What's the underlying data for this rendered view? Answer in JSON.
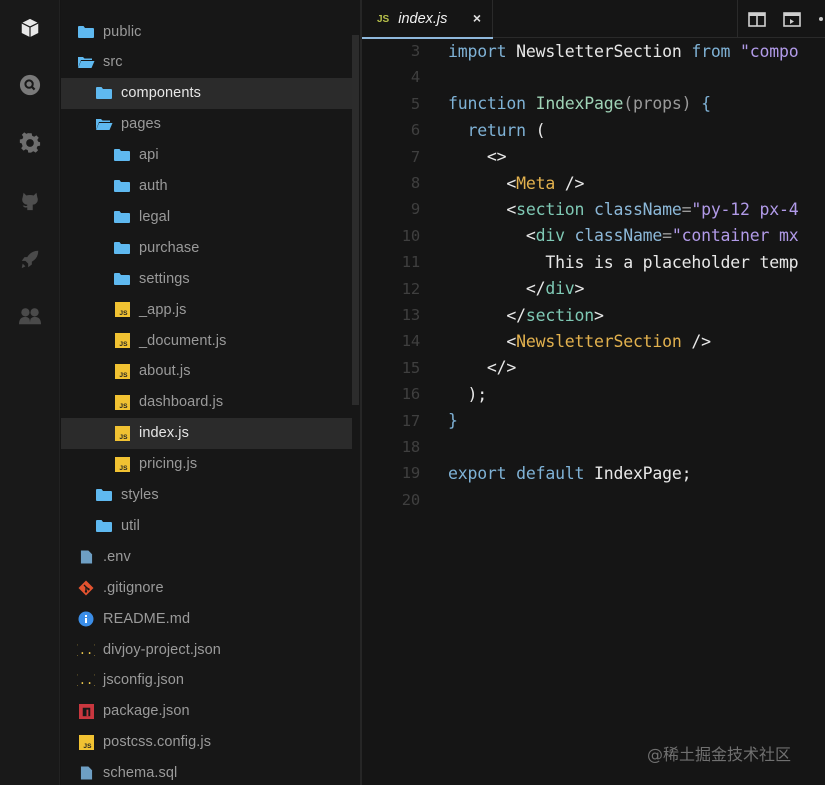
{
  "activity_bar": {
    "items": [
      {
        "icon": "cube-icon",
        "label": "Project"
      },
      {
        "icon": "search-icon",
        "label": "Search"
      },
      {
        "icon": "gear-icon",
        "label": "Settings"
      },
      {
        "icon": "github-icon",
        "label": "GitHub"
      },
      {
        "icon": "rocket-icon",
        "label": "Deploy"
      },
      {
        "icon": "users-icon",
        "label": "Team"
      }
    ]
  },
  "explorer": {
    "items": [
      {
        "label": "public",
        "type": "folder",
        "depth": 0,
        "open": false
      },
      {
        "label": "src",
        "type": "folder",
        "depth": 0,
        "open": true
      },
      {
        "label": "components",
        "type": "folder",
        "depth": 1,
        "open": false,
        "selected": true
      },
      {
        "label": "pages",
        "type": "folder",
        "depth": 1,
        "open": true
      },
      {
        "label": "api",
        "type": "folder",
        "depth": 2,
        "open": false
      },
      {
        "label": "auth",
        "type": "folder",
        "depth": 2,
        "open": false
      },
      {
        "label": "legal",
        "type": "folder",
        "depth": 2,
        "open": false
      },
      {
        "label": "purchase",
        "type": "folder",
        "depth": 2,
        "open": false
      },
      {
        "label": "settings",
        "type": "folder",
        "depth": 2,
        "open": false
      },
      {
        "label": "_app.js",
        "type": "js",
        "depth": 2
      },
      {
        "label": "_document.js",
        "type": "js",
        "depth": 2
      },
      {
        "label": "about.js",
        "type": "js",
        "depth": 2
      },
      {
        "label": "dashboard.js",
        "type": "js",
        "depth": 2
      },
      {
        "label": "index.js",
        "type": "js",
        "depth": 2,
        "selected": true
      },
      {
        "label": "pricing.js",
        "type": "js",
        "depth": 2
      },
      {
        "label": "styles",
        "type": "folder",
        "depth": 1,
        "open": false
      },
      {
        "label": "util",
        "type": "folder",
        "depth": 1,
        "open": false
      },
      {
        "label": ".env",
        "type": "file",
        "depth": 0
      },
      {
        "label": ".gitignore",
        "type": "git",
        "depth": 0
      },
      {
        "label": "README.md",
        "type": "info",
        "depth": 0
      },
      {
        "label": "divjoy-project.json",
        "type": "json",
        "depth": 0
      },
      {
        "label": "jsconfig.json",
        "type": "json",
        "depth": 0
      },
      {
        "label": "package.json",
        "type": "npm",
        "depth": 0
      },
      {
        "label": "postcss.config.js",
        "type": "js",
        "depth": 0
      },
      {
        "label": "schema.sql",
        "type": "file",
        "depth": 0
      }
    ]
  },
  "editor": {
    "tab": {
      "badge": "JS",
      "title": "index.js",
      "close": "×"
    },
    "toolbar": {
      "split_icon": "split-view-icon",
      "preview_icon": "preview-icon",
      "more_icon": "more-icon"
    },
    "lines": [
      {
        "n": "3",
        "tokens": [
          [
            "k",
            "import"
          ],
          [
            "pl",
            " NewsletterSection "
          ],
          [
            "k",
            "from"
          ],
          [
            "pl",
            " "
          ],
          [
            "s",
            "\"compo"
          ]
        ]
      },
      {
        "n": "4",
        "tokens": []
      },
      {
        "n": "5",
        "tokens": [
          [
            "k",
            "function"
          ],
          [
            "pl",
            " "
          ],
          [
            "fn",
            "IndexPage"
          ],
          [
            "p",
            "(props)"
          ],
          [
            "pl",
            " "
          ],
          [
            "k",
            "{"
          ]
        ]
      },
      {
        "n": "6",
        "tokens": [
          [
            "pl",
            "  "
          ],
          [
            "k",
            "return"
          ],
          [
            "pl",
            " ("
          ]
        ]
      },
      {
        "n": "7",
        "tokens": [
          [
            "pl",
            "    <>"
          ]
        ]
      },
      {
        "n": "8",
        "tokens": [
          [
            "pl",
            "      <"
          ],
          [
            "c",
            "Meta"
          ],
          [
            "pl",
            " />"
          ]
        ]
      },
      {
        "n": "9",
        "tokens": [
          [
            "pl",
            "      <"
          ],
          [
            "t",
            "section"
          ],
          [
            "pl",
            " "
          ],
          [
            "a",
            "className"
          ],
          [
            "p",
            "="
          ],
          [
            "s",
            "\"py-12 px-4"
          ]
        ]
      },
      {
        "n": "10",
        "tokens": [
          [
            "pl",
            "        <"
          ],
          [
            "t",
            "div"
          ],
          [
            "pl",
            " "
          ],
          [
            "a",
            "className"
          ],
          [
            "p",
            "="
          ],
          [
            "s",
            "\"container mx"
          ]
        ]
      },
      {
        "n": "11",
        "tokens": [
          [
            "pl",
            "          This is a placeholder temp"
          ]
        ]
      },
      {
        "n": "12",
        "tokens": [
          [
            "pl",
            "        </"
          ],
          [
            "t",
            "div"
          ],
          [
            "pl",
            ">"
          ]
        ]
      },
      {
        "n": "13",
        "tokens": [
          [
            "pl",
            "      </"
          ],
          [
            "t",
            "section"
          ],
          [
            "pl",
            ">"
          ]
        ]
      },
      {
        "n": "14",
        "tokens": [
          [
            "pl",
            "      <"
          ],
          [
            "c",
            "NewsletterSection"
          ],
          [
            "pl",
            " />"
          ]
        ]
      },
      {
        "n": "15",
        "tokens": [
          [
            "pl",
            "    </>"
          ]
        ]
      },
      {
        "n": "16",
        "tokens": [
          [
            "pl",
            "  );"
          ]
        ]
      },
      {
        "n": "17",
        "tokens": [
          [
            "k",
            "}"
          ]
        ]
      },
      {
        "n": "18",
        "tokens": []
      },
      {
        "n": "19",
        "tokens": [
          [
            "k",
            "export"
          ],
          [
            "pl",
            " "
          ],
          [
            "k",
            "default"
          ],
          [
            "pl",
            " IndexPage;"
          ]
        ]
      },
      {
        "n": "20",
        "tokens": []
      }
    ]
  },
  "watermark": "@稀土掘金技术社区",
  "colors": {
    "folder": "#5fb9f0",
    "js_badge": "#f1c232",
    "git": "#e3532f",
    "info": "#3b8ee8",
    "json": "#e8c44a",
    "npm": "#c9373f",
    "file": "#6e9fc4",
    "tab_underline": "#8fb8dc"
  }
}
